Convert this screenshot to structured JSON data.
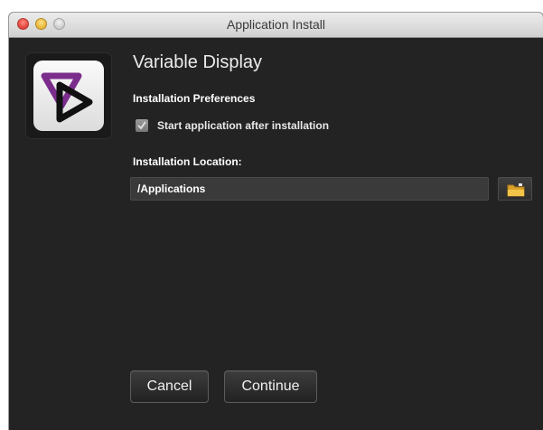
{
  "window": {
    "title": "Application Install",
    "accent": "#232323"
  },
  "app": {
    "name": "Variable Display",
    "icon": "variable-display-logo-icon"
  },
  "preferences": {
    "heading": "Installation Preferences",
    "start_after_install": {
      "label": "Start application after installation",
      "checked": true
    }
  },
  "location": {
    "heading": "Installation Location:",
    "path": "/Applications",
    "browse_icon": "folder-icon"
  },
  "buttons": {
    "cancel": "Cancel",
    "continue": "Continue"
  }
}
